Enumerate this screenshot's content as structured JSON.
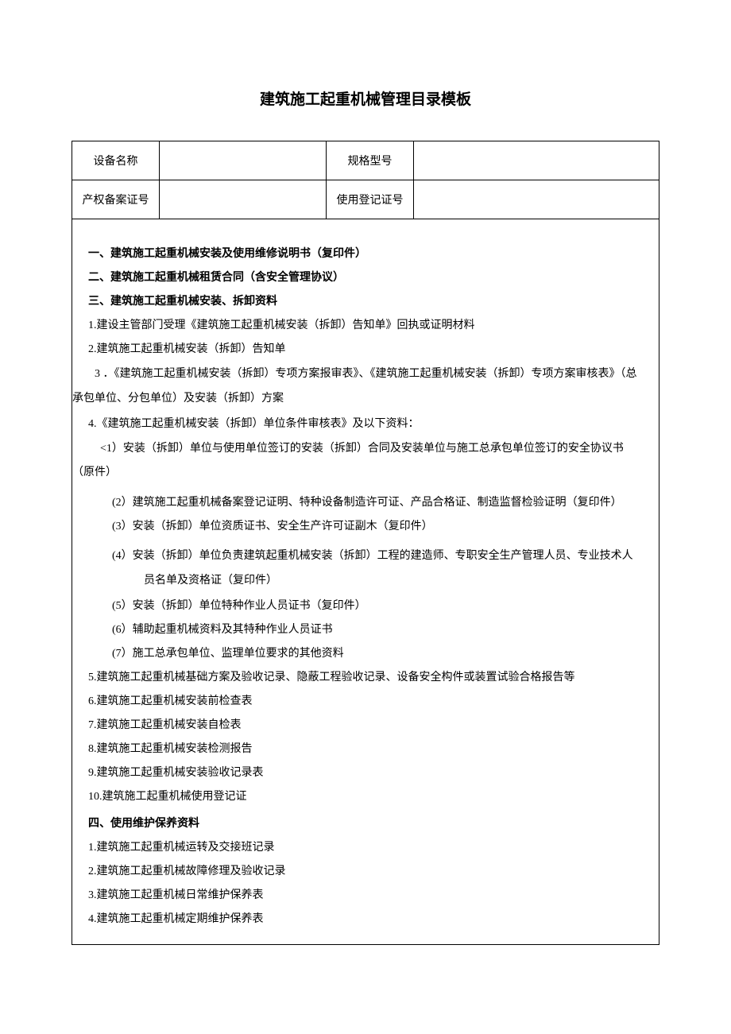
{
  "title": "建筑施工起重机械管理目录模板",
  "header": {
    "equipmentNameLabel": "设备名称",
    "equipmentNameValue": "",
    "specModelLabel": "规格型号",
    "specModelValue": "",
    "propertyCertLabel": "产权备案证号",
    "propertyCertValue": "",
    "useCertLabel": "使用登记证号",
    "useCertValue": ""
  },
  "sections": {
    "s1": "一、建筑施工起重机械安装及使用维修说明书（复印件）",
    "s2": "二、建筑施工起重机械租赁合同（含安全管理协议）",
    "s3": "三、建筑施工起重机械安装、拆卸资料",
    "s3_1": "1.建设主管部门受理《建筑施工起重机械安装（拆卸）告知单》回执或证明材料",
    "s3_2": "2.建筑施工起重机械安装（拆卸）告知单",
    "s3_3": "3 ．《建筑施工起重机械安装（拆卸）专项方案报审表》、《建筑施工起重机械安装（拆卸）专项方案审核表》（总承包单位、分包单位）及安装（拆卸）方案",
    "s3_4": "4.《建筑施工起重机械安装（拆卸）单位条件审核表》及以下资料：",
    "s3_4_1": "<1）安装（拆卸）单位与使用单位签订的安装（拆卸）合同及安装单位与施工总承包单位签订的安全协议书（原件）",
    "s3_4_2": "(2）建筑施工起重机械备案登记证明、特种设备制造许可证、产品合格证、制造监督检验证明（复印件）",
    "s3_4_3": "(3）安装（拆卸）单位资质证书、安全生产许可证副木（复印件）",
    "s3_4_4": "(4）安装（拆卸）单位负责建筑起重机械安装（拆卸）工程的建造师、专职安全生产管理人员、专业技术人员名单及资格证（复印件）",
    "s3_4_5": "(5）安装（拆卸）单位特种作业人员证书（复印件）",
    "s3_4_6": "(6）辅助起重机械资料及其特种作业人员证书",
    "s3_4_7": "(7）施工总承包单位、监理单位要求的其他资料",
    "s3_5": "5.建筑施工起重机械基础方案及验收记录、隐蔽工程验收记录、设备安全构件或装置试验合格报告等",
    "s3_6": "6.建筑施工起重机械安装前检查表",
    "s3_7": "7.建筑施工起重机械安装自检表",
    "s3_8": "8.建筑施工起重机械安装检测报告",
    "s3_9": "9.建筑施工起重机械安装验收记录表",
    "s3_10": "10.建筑施工起重机械使用登记证",
    "s4": "四、使用维护保养资料",
    "s4_1": "1.建筑施工起重机械运转及交接班记录",
    "s4_2": "2.建筑施工起重机械故障修理及验收记录",
    "s4_3": "3.建筑施工起重机械日常维护保养表",
    "s4_4": "4.建筑施工起重机械定期维护保养表"
  }
}
